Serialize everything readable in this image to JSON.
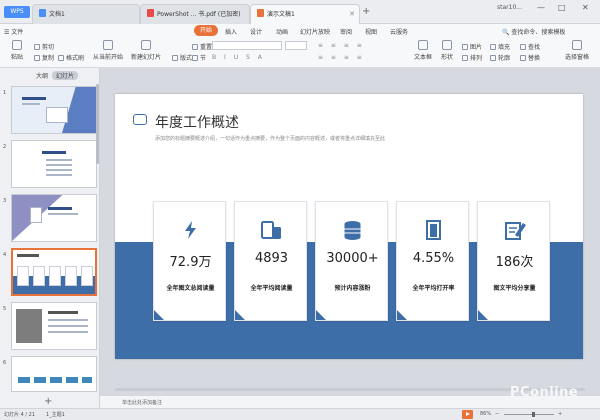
{
  "titlebar": {
    "app_label": "WPS",
    "tabs": [
      {
        "label": "文档1"
      },
      {
        "label": "PowerShot ... 书.pdf (已加密)"
      },
      {
        "label": "演示文稿1"
      }
    ],
    "new_tab": "+",
    "user": "star10...",
    "min": "—",
    "max": "□",
    "close": "✕"
  },
  "menubar": {
    "file": "文件",
    "items": [
      "开始",
      "插入",
      "设计",
      "动画",
      "幻灯片放映",
      "审阅",
      "视图",
      "云服务"
    ],
    "search": "查找命令、搜索模板"
  },
  "ribbon": {
    "paste": "粘贴",
    "cut": "剪切",
    "copy": "复制",
    "format_painter": "格式刷",
    "from_current": "从当前开始",
    "new_slide": "新建幻灯片",
    "layout": "版式",
    "reset": "重置",
    "section": "节",
    "textbox": "文本框",
    "shape": "形状",
    "arrange": "排列",
    "picture": "图片",
    "fill": "填充",
    "outline": "轮廓",
    "find": "查找",
    "replace": "替换",
    "select_pane": "选择窗格"
  },
  "sidebar": {
    "tab_outline": "大纲",
    "tab_slides": "幻灯片",
    "slide_numbers": [
      "1",
      "2",
      "3",
      "4",
      "5",
      "6"
    ],
    "add_slide": "+"
  },
  "slide": {
    "title": "年度工作概述",
    "subtitle": "添加您的标题摘要概述介绍，一句话作为重点摘要，作为整个页面的内容概述，或者将重点详细填充至此",
    "cards": [
      {
        "icon": "lightning-icon",
        "value": "72.9万",
        "label": "全年图文总阅读量"
      },
      {
        "icon": "devices-icon",
        "value": "4893",
        "label": "全年平均阅读量"
      },
      {
        "icon": "database-icon",
        "value": "30000+",
        "label": "预计内容涨粉"
      },
      {
        "icon": "door-icon",
        "value": "4.55%",
        "label": "全年平均打开率"
      },
      {
        "icon": "edit-icon",
        "value": "186次",
        "label": "图文平均分享量"
      }
    ],
    "accent_color": "#3e6ea8"
  },
  "notes": {
    "placeholder": "单击此处添加备注"
  },
  "statusbar": {
    "slide_pos": "幻灯片 4 / 21",
    "theme": "1_主题1",
    "zoom": "86%",
    "zoom_minus": "−",
    "zoom_plus": "+"
  },
  "watermark": "PConline",
  "colors": {
    "accent": "#e9713a",
    "brand_blue": "#4a8ff7"
  }
}
